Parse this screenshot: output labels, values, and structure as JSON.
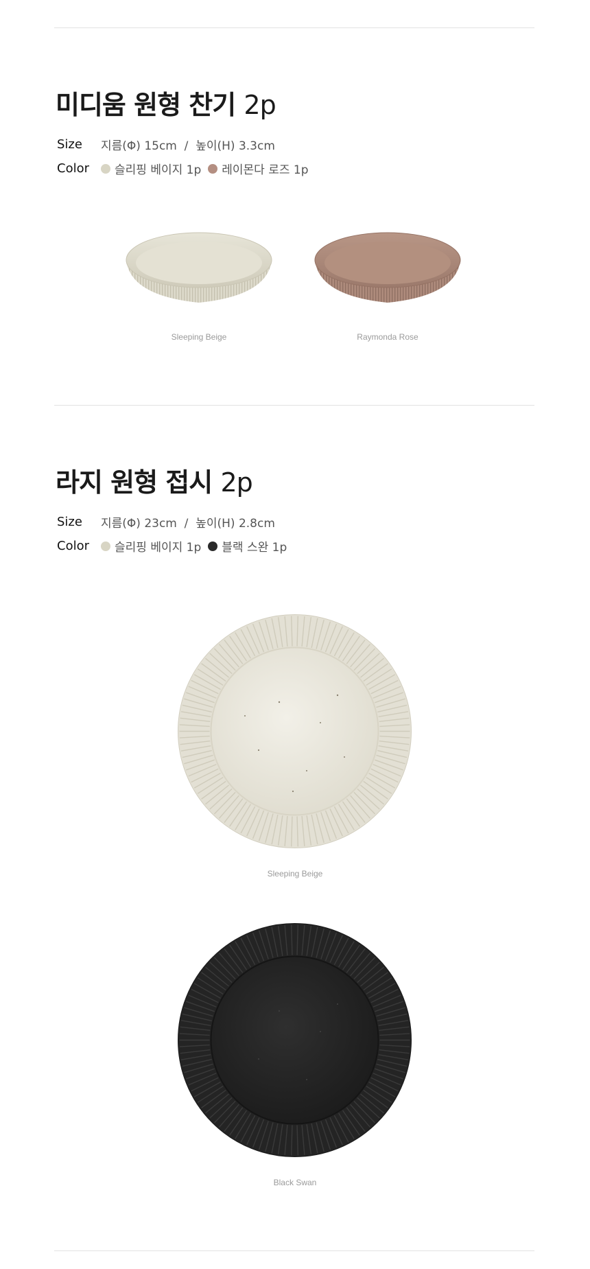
{
  "section1": {
    "title": "미디움 원형 찬기",
    "qty": "2p",
    "size_label": "Size",
    "size_value": "지름(Φ) 15cm  /  높이(H) 3.3cm",
    "color_label": "Color",
    "colors": [
      {
        "name": "슬리핑 베이지 1p",
        "hex": "#d8d5c4"
      },
      {
        "name": "레이몬다 로즈 1p",
        "hex": "#b48f82"
      }
    ],
    "captions": [
      "Sleeping Beige",
      "Raymonda Rose"
    ]
  },
  "section2": {
    "title": "라지 원형 접시",
    "qty": "2p",
    "size_label": "Size",
    "size_value": "지름(Φ) 23cm  /  높이(H) 2.8cm",
    "color_label": "Color",
    "colors": [
      {
        "name": "슬리핑 베이지 1p",
        "hex": "#d8d5c4"
      },
      {
        "name": "블랙 스완 1p",
        "hex": "#2a2a2a"
      }
    ],
    "captions": [
      "Sleeping Beige",
      "Black Swan"
    ]
  }
}
